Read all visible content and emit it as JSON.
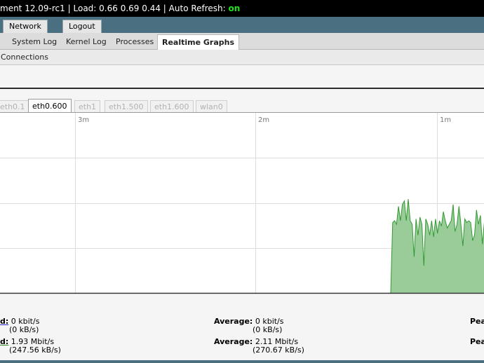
{
  "topbar": {
    "title_fragment": "ment 12.09-rc1",
    "load_label": "Load:",
    "load_values": "0.66 0.69 0.44",
    "refresh_label": "Auto Refresh:",
    "refresh_state": "on"
  },
  "main_nav": {
    "network": "Network",
    "logout": "Logout"
  },
  "sub_nav": {
    "system_log": "System Log",
    "kernel_log": "Kernel Log",
    "processes": "Processes",
    "realtime_graphs": "Realtime Graphs"
  },
  "sub_sub_nav": {
    "connections": "Connections"
  },
  "interfaces": [
    "eth0.1",
    "eth0.600",
    "eth1",
    "eth1.500",
    "eth1.600",
    "wlan0"
  ],
  "active_interface": "eth0.600",
  "graph": {
    "time_labels": [
      "3m",
      "2m",
      "1m"
    ],
    "fill_color": "#99cc99",
    "stroke_color": "#339933"
  },
  "chart_data": {
    "type": "area",
    "series": [
      {
        "values": [
          0.0,
          1.95,
          2.0,
          1.9,
          2.4,
          2.0,
          2.45,
          2.55,
          2.0,
          2.6,
          2.0,
          1.9,
          1.0,
          2.05,
          1.6,
          2.1,
          1.9,
          0.75,
          2.05,
          1.9,
          1.6,
          2.0,
          1.55,
          2.05,
          1.65,
          2.0,
          1.85,
          2.25,
          2.0,
          1.8,
          1.9,
          2.0,
          2.45,
          1.7,
          1.9,
          2.4,
          1.9,
          1.3,
          2.05,
          1.95,
          2.0,
          1.95,
          1.45,
          1.6,
          2.3,
          1.9,
          2.15,
          1.35,
          1.95
        ]
      }
    ]
  },
  "stats": {
    "row1": {
      "label_fragment": "d:",
      "current_kbit": "0 kbit/s",
      "current_kB": "(0 kB/s)",
      "avg_label": "Average:",
      "avg_kbit": "0 kbit/s",
      "avg_kB": "(0 kB/s)",
      "peak_fragment": "Pea"
    },
    "row2": {
      "label_fragment": "d:",
      "current_kbit": "1.93 Mbit/s",
      "current_kB": "(247.56 kB/s)",
      "avg_label": "Average:",
      "avg_kbit": "2.11 Mbit/s",
      "avg_kB": "(270.67 kB/s)",
      "peak_fragment": "Pea"
    }
  }
}
